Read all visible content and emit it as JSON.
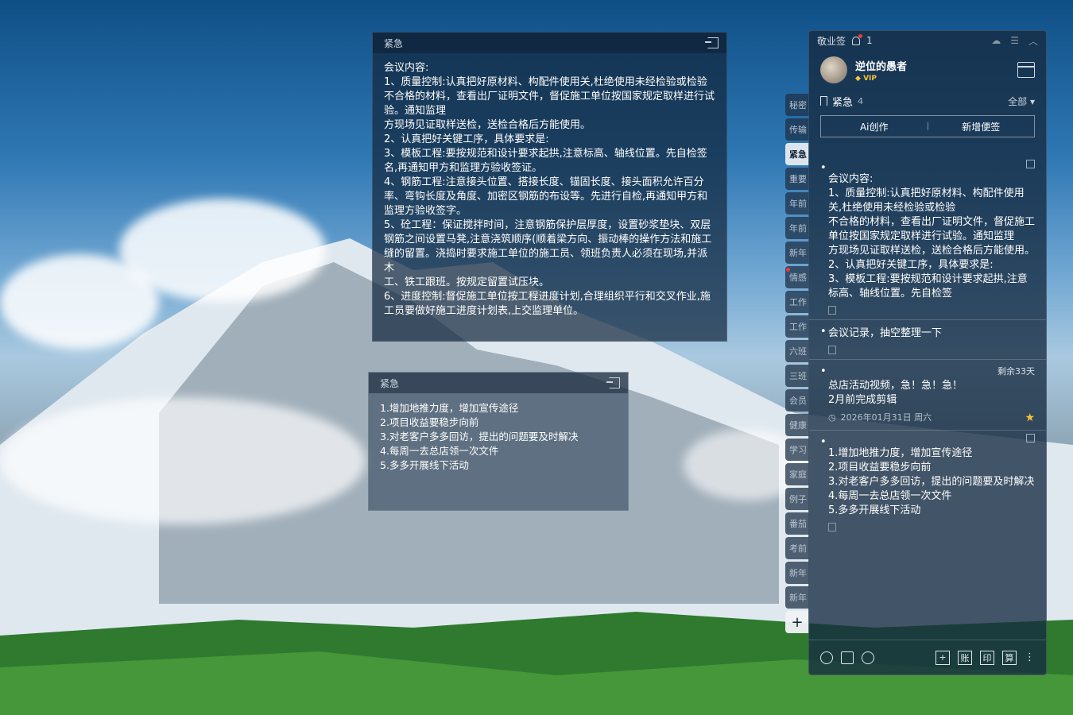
{
  "note1": {
    "header": "紧急",
    "body": "会议内容:\n1、质量控制:认真把好原材料、构配件使用关,杜绝使用未经检验或检验不合格的材料，查看出厂证明文件，督促施工单位按国家规定取样进行试验。通知监理\n方现场见证取样送检，送检合格后方能使用。\n2、认真把好关键工序，具体要求是:\n3、模板工程:要按规范和设计要求起拱,注意标高、轴线位置。先自检签名,再通知甲方和监理方验收签证。\n4、钢筋工程:注意接头位置、搭接长度、锚固长度、接头面积允许百分率、弯钩长度及角度、加密区钢筋的布设等。先进行自检,再通知甲方和监理方验收签字。\n5、砼工程：保证搅拌时间，注意钢筋保护层厚度，设置砂浆垫块、双层钢筋之间设置马凳,注意浇筑顺序(顺着梁方向、振动棒的操作方法和施工缝的留置。浇捣时要求施工单位的施工员、领班负责人必须在现场,并派木\n工、铁工跟班。按规定留置试压块。\n6、进度控制:督促施工单位按工程进度计划,合理组织平行和交叉作业,施工员要做好施工进度计划表,上交监理单位。"
  },
  "note2": {
    "header": "紧急",
    "body": "1.增加地推力度，增加宣传途径\n2.项目收益要稳步向前\n3.对老客户多多回访，提出的问题要及时解决\n4.每周一去总店领一次文件\n5.多多开展线下活动"
  },
  "side_tabs": [
    {
      "label": "秘密",
      "active": false,
      "dot": false
    },
    {
      "label": "传输",
      "active": false,
      "dot": false
    },
    {
      "label": "紧急",
      "active": true,
      "dot": false
    },
    {
      "label": "重要",
      "active": false,
      "dot": false
    },
    {
      "label": "年前",
      "active": false,
      "dot": false
    },
    {
      "label": "年前",
      "active": false,
      "dot": false
    },
    {
      "label": "新年",
      "active": false,
      "dot": false
    },
    {
      "label": "情感",
      "active": false,
      "dot": true
    },
    {
      "label": "工作",
      "active": false,
      "dot": false
    },
    {
      "label": "工作",
      "active": false,
      "dot": false
    },
    {
      "label": "六班",
      "active": false,
      "dot": false
    },
    {
      "label": "三班",
      "active": false,
      "dot": false
    },
    {
      "label": "会员",
      "active": false,
      "dot": false
    },
    {
      "label": "健康",
      "active": false,
      "dot": false
    },
    {
      "label": "学习",
      "active": false,
      "dot": false
    },
    {
      "label": "家庭",
      "active": false,
      "dot": false
    },
    {
      "label": "例子",
      "active": false,
      "dot": false
    },
    {
      "label": "番茄",
      "active": false,
      "dot": false
    },
    {
      "label": "考前",
      "active": false,
      "dot": false
    },
    {
      "label": "新年",
      "active": false,
      "dot": false
    },
    {
      "label": "新年",
      "active": false,
      "dot": false
    }
  ],
  "side_add": "+",
  "panel": {
    "app_name": "敬业签",
    "notif_count": "1",
    "user_name": "逆位的愚者",
    "vip": "VIP",
    "category": "紧急",
    "category_count": "4",
    "filter": "全部 ▾",
    "ai_button": "Ai创作",
    "new_button": "新增便签",
    "items": [
      {
        "text": "会议内容:\n1、质量控制:认真把好原材料、构配件使用关,杜绝使用未经检验或检验\n不合格的材料，查看出厂证明文件，督促施工单位按国家规定取样进行试验。通知监理\n方现场见证取样送检，送检合格后方能使用。\n2、认真把好关键工序，具体要求是:\n3、模板工程:要按规范和设计要求起拱,注意标高、轴线位置。先自检签"
      },
      {
        "text": "会议记录，抽空整理一下"
      },
      {
        "remaining": "剩余33天",
        "text": "总店活动视频，急！急！急！\n2月前完成剪辑",
        "date": "2026年01月31日 周六"
      },
      {
        "text": "1.增加地推力度，增加宣传途径\n2.项目收益要稳步向前\n3.对老客户多多回访，提出的问题要及时解决\n4.每周一去总店领一次文件\n5.多多开展线下活动"
      }
    ],
    "bottom_boxes": [
      "+",
      "账",
      "印",
      "算"
    ]
  }
}
